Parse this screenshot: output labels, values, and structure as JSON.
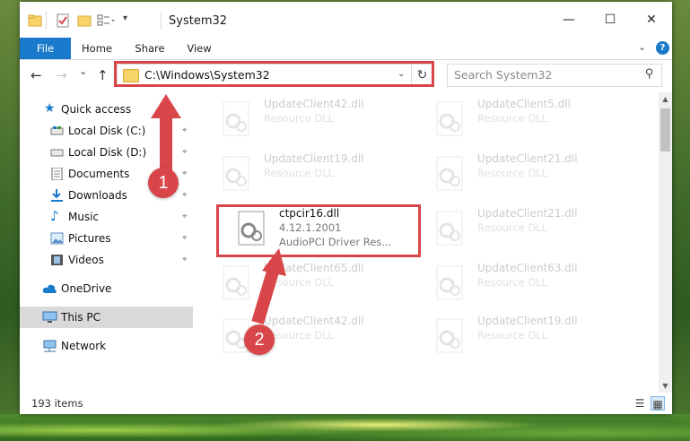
{
  "window": {
    "title": "System32",
    "controls": {
      "minimize": "—",
      "maximize": "☐",
      "close": "✕"
    }
  },
  "ribbon": {
    "tabs": [
      "File",
      "Home",
      "Share",
      "View"
    ],
    "expand_glyph": "⌄",
    "help_glyph": "?"
  },
  "navigation": {
    "back_glyph": "←",
    "forward_glyph": "→",
    "recent_glyph": "⌄",
    "up_glyph": "↑",
    "address": "C:\\Windows\\System32",
    "address_dropdown_glyph": "⌄",
    "refresh_glyph": "↻",
    "search_placeholder": "Search System32",
    "search_glyph": "⚲"
  },
  "sidebar": {
    "quick_access": "Quick access",
    "items": [
      {
        "label": "Local Disk (C:)",
        "icon": "drive-icon",
        "pinned": true
      },
      {
        "label": "Local Disk (D:)",
        "icon": "drive-icon",
        "pinned": true
      },
      {
        "label": "Documents",
        "icon": "documents-icon",
        "pinned": true
      },
      {
        "label": "Downloads",
        "icon": "downloads-icon",
        "pinned": true
      },
      {
        "label": "Music",
        "icon": "music-icon",
        "pinned": true
      },
      {
        "label": "Pictures",
        "icon": "pictures-icon",
        "pinned": true
      },
      {
        "label": "Videos",
        "icon": "videos-icon",
        "pinned": true
      }
    ],
    "onedrive": "OneDrive",
    "this_pc": "This PC",
    "network": "Network",
    "pin_glyph": "📌"
  },
  "files": [
    {
      "name": "UpdateClient42.dll",
      "desc": "Resource DLL",
      "faded": true
    },
    {
      "name": "UpdateClient5.dll",
      "desc": "Resource DLL",
      "faded": true
    },
    {
      "name": "UpdateClient19.dll",
      "desc": "Resource DLL",
      "faded": true
    },
    {
      "name": "UpdateClient21.dll",
      "desc": "Resource DLL",
      "faded": true
    },
    {
      "name": "ctpcir16.dll",
      "version": "4.12.1.2001",
      "desc": "AudioPCI Driver Res...",
      "faded": false,
      "highlighted": true
    },
    {
      "name": "UpdateClient21.dll",
      "desc": "Resource DLL",
      "faded": true
    },
    {
      "name": "UpdateClient65.dll",
      "desc": "Resource DLL",
      "faded": true
    },
    {
      "name": "UpdateClient63.dll",
      "desc": "Resource DLL",
      "faded": true
    },
    {
      "name": "UpdateClient42.dll",
      "desc": "Resource DLL",
      "faded": true
    },
    {
      "name": "UpdateClient19.dll",
      "desc": "Resource DLL",
      "faded": true
    }
  ],
  "status": {
    "item_count": "193 items"
  },
  "annotations": {
    "step1": "1",
    "step2": "2",
    "color": "#d9464a"
  },
  "colors": {
    "accent": "#1979ca",
    "folder": "#f7d46a",
    "highlight": "#d9464a"
  }
}
